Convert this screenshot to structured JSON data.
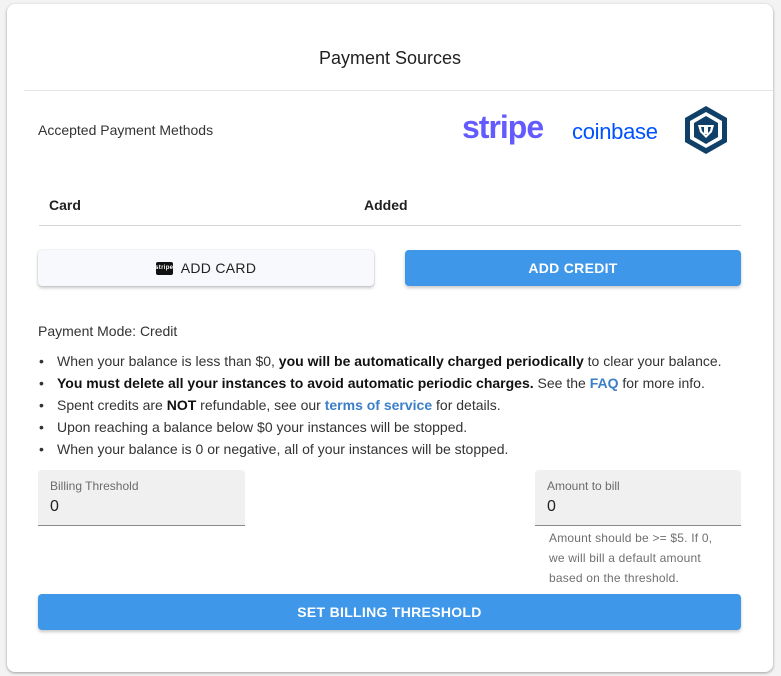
{
  "header": {
    "title": "Payment Sources"
  },
  "accepted": {
    "label": "Accepted Payment Methods",
    "logos": [
      {
        "name": "stripe",
        "text": "stripe",
        "color": "#635bff"
      },
      {
        "name": "coinbase",
        "text": "coinbase",
        "color": "#0052ff"
      },
      {
        "name": "crypto-com",
        "icon": "crypto-com-lion-shield-icon",
        "color": "#103f68"
      }
    ]
  },
  "table": {
    "columns": [
      "Card",
      "Added"
    ]
  },
  "buttons": {
    "add_card": "ADD CARD",
    "add_card_badge": "stripe",
    "add_credit": "ADD CREDIT",
    "set_threshold": "SET BILLING THRESHOLD"
  },
  "mode": {
    "label": "Payment Mode: Credit"
  },
  "bullets": [
    {
      "parts": [
        "When your balance is less than $0, ",
        "you will be automatically charged periodically",
        " to clear your balance."
      ]
    },
    {
      "parts": [
        "You must delete all your instances to avoid automatic periodic charges.",
        " See the ",
        "FAQ",
        " for more info."
      ]
    },
    {
      "parts": [
        "Spent credits are ",
        "NOT",
        " refundable, see our ",
        "terms of service",
        " for details."
      ]
    },
    {
      "text": "Upon reaching a balance below $0 your instances will be stopped."
    },
    {
      "text": "When your balance is 0 or negative, all of your instances will be stopped."
    }
  ],
  "billing_threshold": {
    "label": "Billing Threshold",
    "value": "0"
  },
  "amount_to_bill": {
    "label": "Amount to bill",
    "value": "0",
    "hint": "Amount should be >= $5. If 0, we will bill a default amount based on the threshold."
  },
  "colors": {
    "primary": "#3f97e9",
    "link": "#3b7fc8"
  }
}
